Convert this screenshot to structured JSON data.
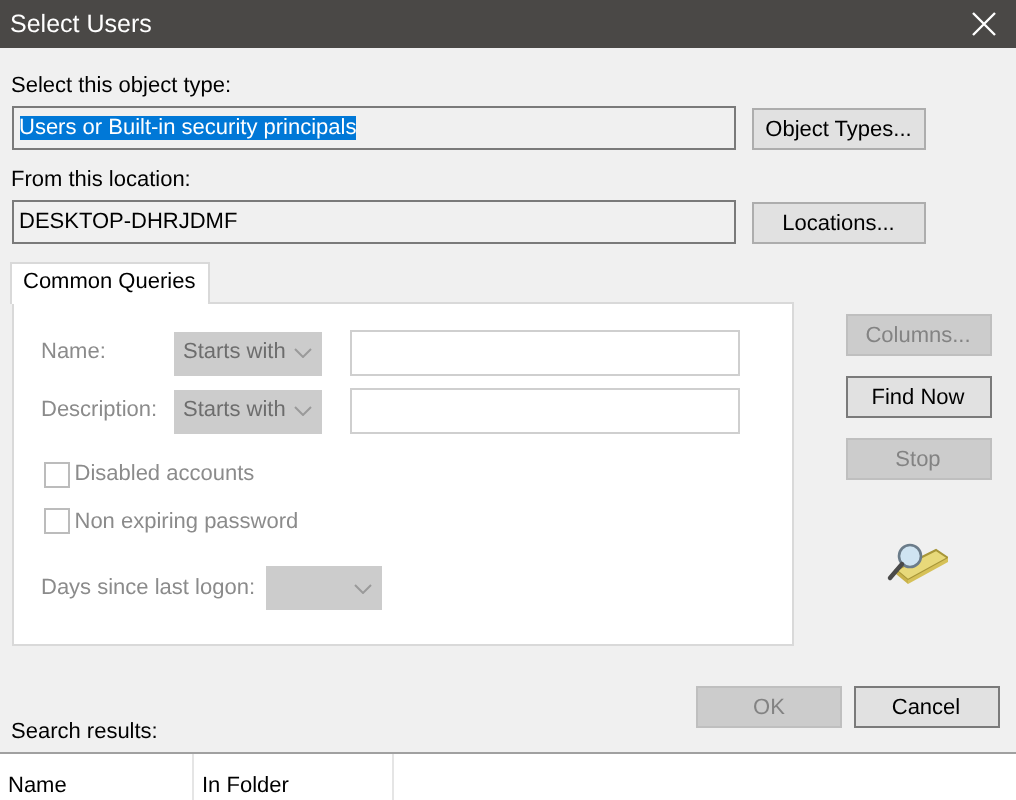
{
  "window": {
    "title": "Select Users"
  },
  "object_type": {
    "label": "Select this object type:",
    "value": "Users or Built-in security principals",
    "selected": true,
    "button": "Object Types..."
  },
  "location": {
    "label": "From this location:",
    "value": "DESKTOP-DHRJDMF",
    "selected": false,
    "button": "Locations..."
  },
  "tabs": [
    {
      "label": "Common Queries",
      "selected": true
    }
  ],
  "query_fields": [
    {
      "label": "Name:",
      "operator": "Starts with",
      "disabled": true
    },
    {
      "label": "Description:",
      "operator": "Starts with",
      "disabled": true
    }
  ],
  "checkboxes": [
    {
      "label": "Disabled accounts",
      "checked": false,
      "disabled": true
    },
    {
      "label": "Non expiring password",
      "checked": false,
      "disabled": true
    }
  ],
  "days_since_last_logon": {
    "label": "Days since last logon:",
    "disabled": true
  },
  "side_buttons": [
    {
      "label": "Columns...",
      "disabled": true
    },
    {
      "label": "Find Now",
      "disabled": false
    },
    {
      "label": "Stop",
      "disabled": true
    }
  ],
  "dialog_buttons": [
    {
      "label": "OK",
      "disabled": true
    },
    {
      "label": "Cancel",
      "disabled": false
    }
  ],
  "search_results": {
    "label": "Search results:",
    "columns": [
      "Name",
      "In Folder"
    ]
  }
}
